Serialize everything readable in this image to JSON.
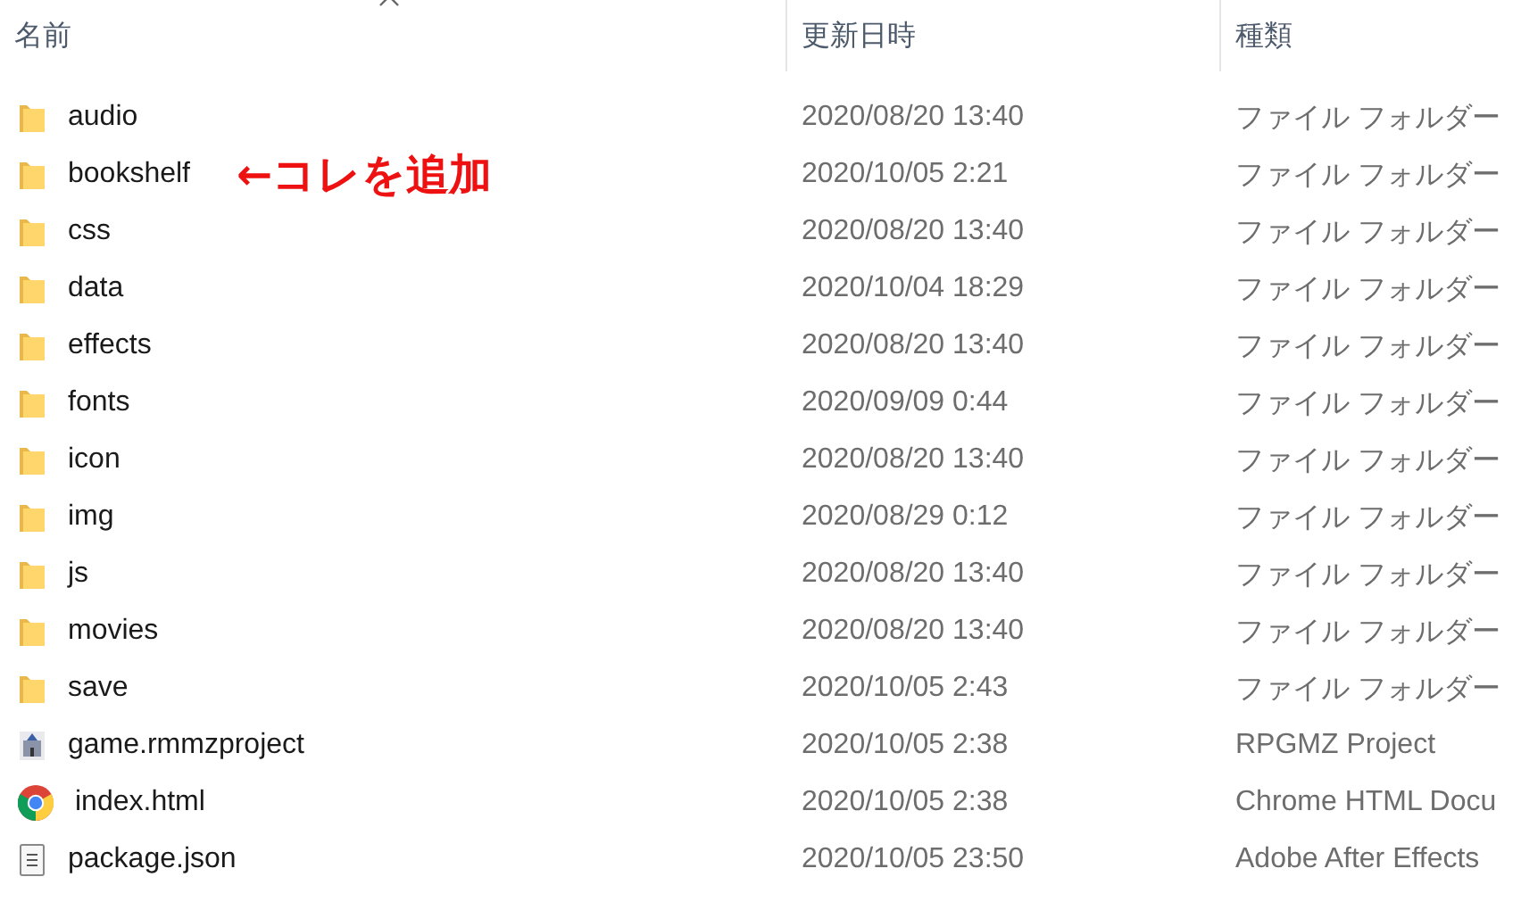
{
  "columns": [
    "名前",
    "更新日時",
    "種類"
  ],
  "rows": [
    {
      "kind": "folder",
      "name": "audio",
      "modified": "2020/08/20 13:40",
      "type": "ファイル フォルダー"
    },
    {
      "kind": "folder",
      "name": "bookshelf",
      "modified": "2020/10/05 2:21",
      "type": "ファイル フォルダー",
      "note": "←コレを追加"
    },
    {
      "kind": "folder",
      "name": "css",
      "modified": "2020/08/20 13:40",
      "type": "ファイル フォルダー"
    },
    {
      "kind": "folder",
      "name": "data",
      "modified": "2020/10/04 18:29",
      "type": "ファイル フォルダー"
    },
    {
      "kind": "folder",
      "name": "effects",
      "modified": "2020/08/20 13:40",
      "type": "ファイル フォルダー"
    },
    {
      "kind": "folder",
      "name": "fonts",
      "modified": "2020/09/09 0:44",
      "type": "ファイル フォルダー"
    },
    {
      "kind": "folder",
      "name": "icon",
      "modified": "2020/08/20 13:40",
      "type": "ファイル フォルダー"
    },
    {
      "kind": "folder",
      "name": "img",
      "modified": "2020/08/29 0:12",
      "type": "ファイル フォルダー"
    },
    {
      "kind": "folder",
      "name": "js",
      "modified": "2020/08/20 13:40",
      "type": "ファイル フォルダー"
    },
    {
      "kind": "folder",
      "name": "movies",
      "modified": "2020/08/20 13:40",
      "type": "ファイル フォルダー"
    },
    {
      "kind": "folder",
      "name": "save",
      "modified": "2020/10/05 2:43",
      "type": "ファイル フォルダー"
    },
    {
      "kind": "project",
      "name": "game.rmmzproject",
      "modified": "2020/10/05 2:38",
      "type": "RPGMZ Project"
    },
    {
      "kind": "browser",
      "name": "index.html",
      "modified": "2020/10/05 2:38",
      "type": "Chrome HTML Docu"
    },
    {
      "kind": "document",
      "name": "package.json",
      "modified": "2020/10/05 23:50",
      "type": "Adobe After Effects"
    }
  ]
}
